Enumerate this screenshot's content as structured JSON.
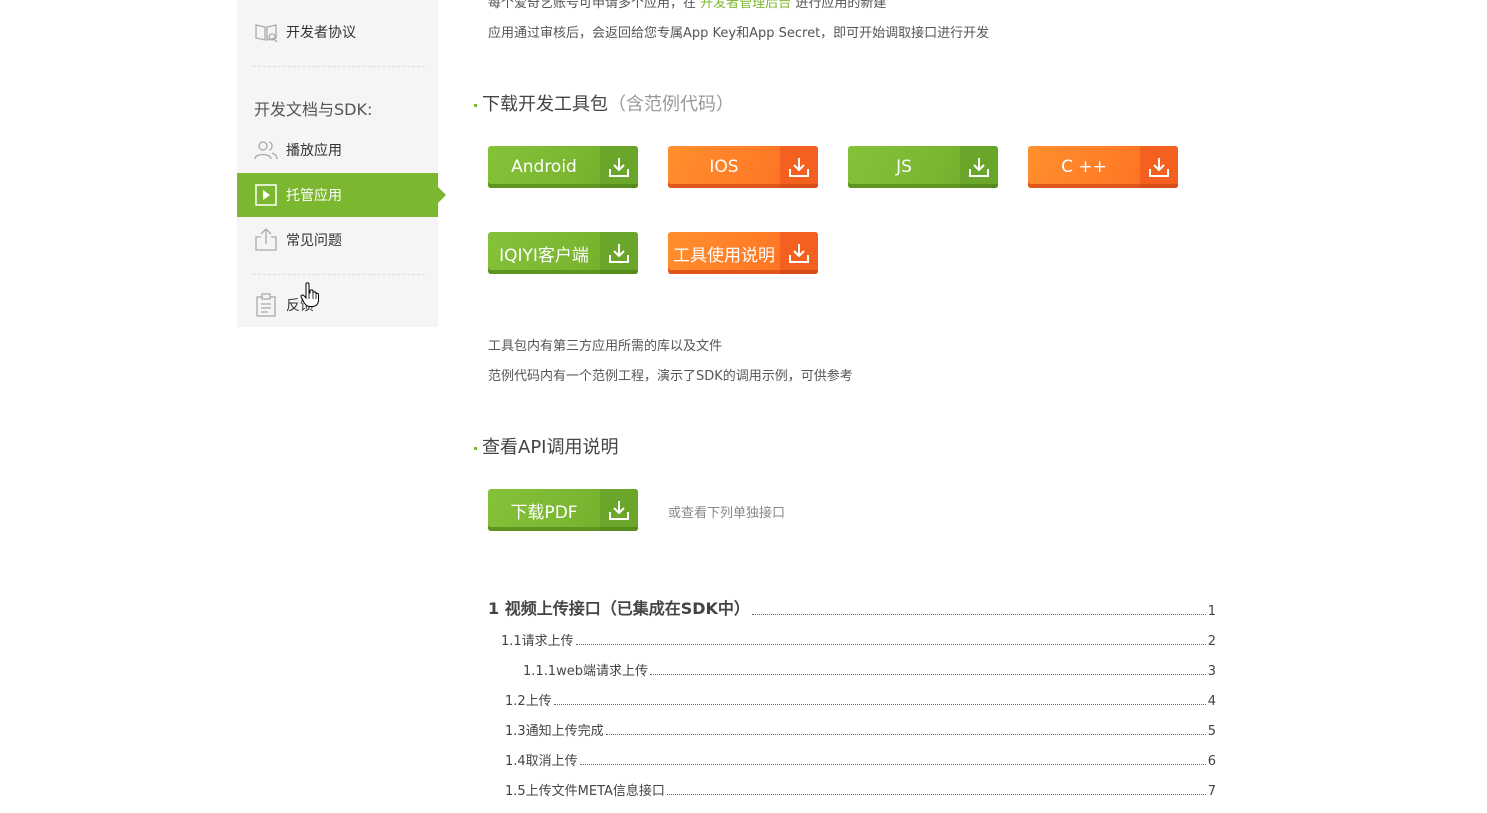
{
  "sidebar": {
    "agreement": "开发者协议",
    "heading": "开发文档与SDK:",
    "items": [
      {
        "label": "播放应用",
        "icon": "users-icon"
      },
      {
        "label": "托管应用",
        "icon": "play-square-icon",
        "active": true
      },
      {
        "label": "常见问题",
        "icon": "upload-icon"
      },
      {
        "label": "反馈",
        "icon": "clipboard-icon"
      }
    ]
  },
  "intro": {
    "line1_prefix": "每个爱奇艺账号可申请多个应用，在",
    "line1_link": "开发者管理后台",
    "line1_suffix": "进行应用的新建",
    "line2": "应用通过审核后，会返回给您专属App Key和App Secret，即可开始调取接口进行开发"
  },
  "sdk_section": {
    "title": "下载开发工具包",
    "title_note": "（含范例代码）",
    "buttons": [
      {
        "label": "Android",
        "color": "#7cb82f"
      },
      {
        "label": "IOS",
        "color": "#ff7b26"
      },
      {
        "label": "JS",
        "color": "#7cb82f"
      },
      {
        "label": "C ++",
        "color": "#ff7b26"
      },
      {
        "label": "IQIYI客户端",
        "color": "#7cb82f"
      },
      {
        "label": "工具使用说明",
        "color": "#ff7b26"
      }
    ],
    "note1": "工具包内有第三方应用所需的库以及文件",
    "note2": "范例代码内有一个范例工程，演示了SDK的调用示例，可供参考"
  },
  "api_section": {
    "title": "查看API调用说明",
    "pdf_button": "下载PDF",
    "hint": "或查看下列单独接口"
  },
  "toc": [
    {
      "title": "1 视频上传接口（已集成在SDK中）",
      "page": "1",
      "level": 1
    },
    {
      "title": "1.1请求上传",
      "page": "2",
      "level": 2
    },
    {
      "title": "1.1.1web端请求上传",
      "page": "3",
      "level": 3
    },
    {
      "title": "1.2上传",
      "page": "4",
      "level": 2
    },
    {
      "title": "1.3通知上传完成",
      "page": "5",
      "level": 2
    },
    {
      "title": "1.4取消上传",
      "page": "6",
      "level": 2
    },
    {
      "title": "1.5上传文件META信息接口",
      "page": "7",
      "level": 2
    }
  ],
  "colors": {
    "accent_green": "#7cb82f",
    "accent_orange": "#ff7b26"
  }
}
